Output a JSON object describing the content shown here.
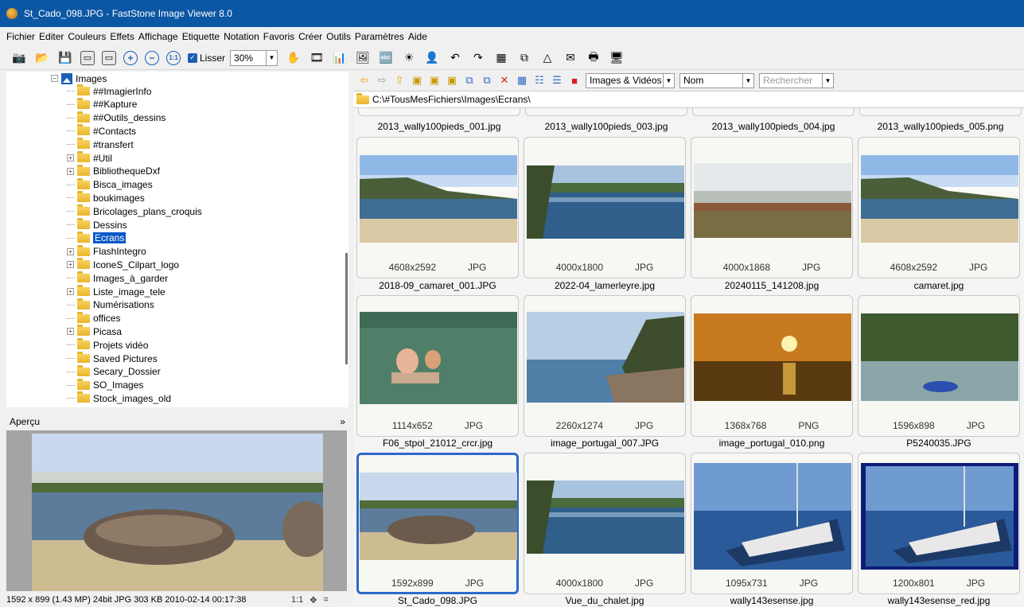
{
  "window": {
    "title": "St_Cado_098.JPG  -  FastStone Image Viewer 8.0"
  },
  "menu": [
    "Fichier",
    "Editer",
    "Couleurs",
    "Effets",
    "Affichage",
    "Etiquette",
    "Notation",
    "Favoris",
    "Créer",
    "Outils",
    "Paramètres",
    "Aide"
  ],
  "toolbar": {
    "smooth_label": "Lisser",
    "zoom_value": "30%"
  },
  "tree": {
    "root": "Images",
    "items": [
      "##ImagierInfo",
      "##Kapture",
      "##Outils_dessins",
      "#Contacts",
      "#transfert",
      "#Util",
      "BibliothequeDxf",
      "Bisca_images",
      "boukimages",
      "Bricolages_plans_croquis",
      "Dessins",
      "Ecrans",
      "FlashIntegro",
      "IconeS_Cilpart_logo",
      "Images_à_garder",
      "Liste_image_tele",
      "Numérisations",
      "offices",
      "Picasa",
      "Projets vidéo",
      "Saved Pictures",
      "Secary_Dossier",
      "SO_Images",
      "Stock_images_old"
    ],
    "selected": "Ecrans"
  },
  "preview": {
    "label": "Aperçu",
    "collapse_icon": "»"
  },
  "status": {
    "info": "1592 x 899 (1.43 MP)  24bit  JPG  303 KB  2010-02-14 00:17:38",
    "ratio": "1:1"
  },
  "browser": {
    "filter": "Images & Vidéos",
    "sort": "Nom",
    "search_placeholder": "Rechercher",
    "path": "C:\\#TousMesFichiers\\Images\\Ecrans\\",
    "top_row_names": [
      "2013_wally100pieds_001.jpg",
      "2013_wally100pieds_003.jpg",
      "2013_wally100pieds_004.jpg",
      "2013_wally100pieds_005.png"
    ],
    "files": [
      {
        "name": "2018-09_camaret_001.JPG",
        "dims": "4608x2592",
        "type": "JPG"
      },
      {
        "name": "2022-04_lamerleyre.jpg",
        "dims": "4000x1800",
        "type": "JPG"
      },
      {
        "name": "20240115_141208.jpg",
        "dims": "4000x1868",
        "type": "JPG"
      },
      {
        "name": "camaret.jpg",
        "dims": "4608x2592",
        "type": "JPG"
      },
      {
        "name": "F06_stpol_21012_crcr.jpg",
        "dims": "1114x652",
        "type": "JPG"
      },
      {
        "name": "image_portugal_007.JPG",
        "dims": "2260x1274",
        "type": "JPG"
      },
      {
        "name": "image_portugal_010.png",
        "dims": "1368x768",
        "type": "PNG"
      },
      {
        "name": "P5240035.JPG",
        "dims": "1596x898",
        "type": "JPG"
      },
      {
        "name": "St_Cado_098.JPG",
        "dims": "1592x899",
        "type": "JPG"
      },
      {
        "name": "Vue_du_chalet.jpg",
        "dims": "4000x1800",
        "type": "JPG"
      },
      {
        "name": "wally143esense.jpg",
        "dims": "1095x731",
        "type": "JPG"
      },
      {
        "name": "wally143esense_red.jpg",
        "dims": "1200x801",
        "type": "JPG"
      }
    ]
  }
}
